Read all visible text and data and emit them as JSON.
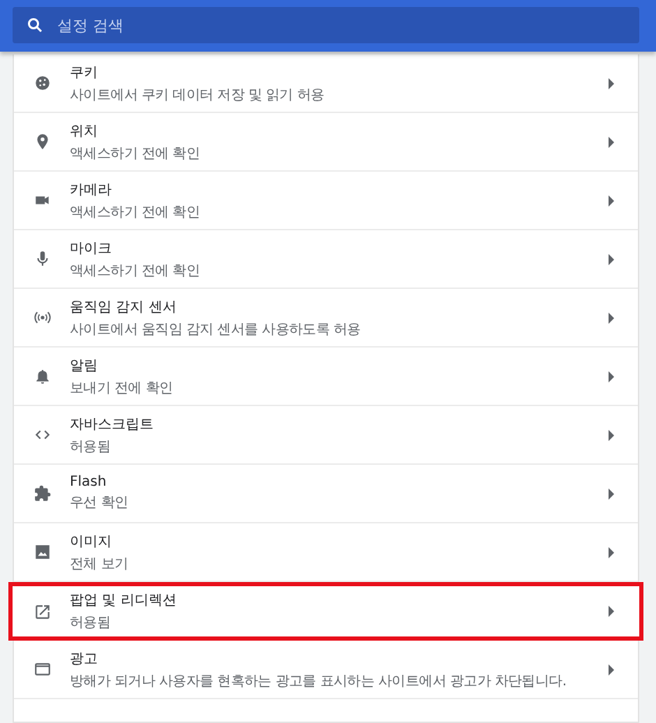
{
  "search": {
    "placeholder": "설정 검색"
  },
  "items": [
    {
      "kind": "cookie",
      "title": "쿠키",
      "subtitle": "사이트에서 쿠키 데이터 저장 및 읽기 허용",
      "highlighted": false
    },
    {
      "kind": "location",
      "title": "위치",
      "subtitle": "액세스하기 전에 확인",
      "highlighted": false
    },
    {
      "kind": "camera",
      "title": "카메라",
      "subtitle": "액세스하기 전에 확인",
      "highlighted": false
    },
    {
      "kind": "mic",
      "title": "마이크",
      "subtitle": "액세스하기 전에 확인",
      "highlighted": false
    },
    {
      "kind": "sensor",
      "title": "움직임 감지 센서",
      "subtitle": "사이트에서 움직임 감지 센서를 사용하도록 허용",
      "highlighted": false
    },
    {
      "kind": "bell",
      "title": "알림",
      "subtitle": "보내기 전에 확인",
      "highlighted": false
    },
    {
      "kind": "code",
      "title": "자바스크립트",
      "subtitle": "허용됨",
      "highlighted": false
    },
    {
      "kind": "puzzle",
      "title": "Flash",
      "subtitle": "우선 확인",
      "highlighted": false
    },
    {
      "kind": "image",
      "title": "이미지",
      "subtitle": "전체 보기",
      "highlighted": false
    },
    {
      "kind": "popup",
      "title": "팝업 및 리디렉션",
      "subtitle": "허용됨",
      "highlighted": true
    },
    {
      "kind": "ads",
      "title": "광고",
      "subtitle": "방해가 되거나 사용자를 현혹하는 광고를 표시하는 사이트에서 광고가 차단됩니다.",
      "highlighted": false
    }
  ]
}
